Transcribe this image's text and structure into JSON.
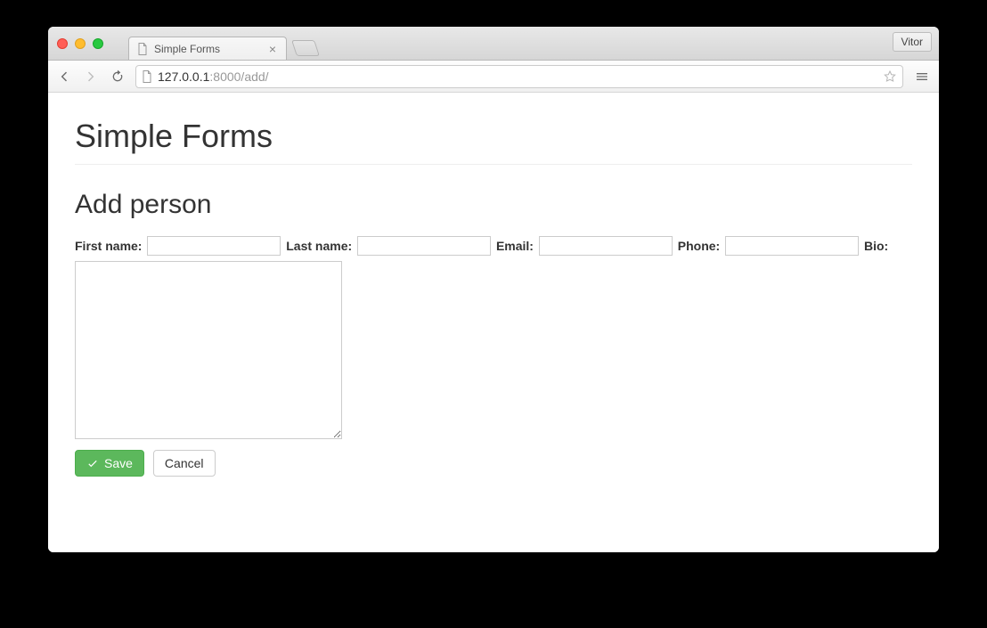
{
  "browser": {
    "tab_title": "Simple Forms",
    "user_chip": "Vitor",
    "url_host": "127.0.0.1",
    "url_rest": ":8000/add/"
  },
  "page": {
    "site_title": "Simple Forms",
    "heading": "Add person",
    "fields": {
      "first_name": {
        "label": "First name:",
        "value": ""
      },
      "last_name": {
        "label": "Last name:",
        "value": ""
      },
      "email": {
        "label": "Email:",
        "value": ""
      },
      "phone": {
        "label": "Phone:",
        "value": ""
      },
      "bio": {
        "label": "Bio:",
        "value": ""
      }
    },
    "buttons": {
      "save": "Save",
      "cancel": "Cancel"
    }
  }
}
